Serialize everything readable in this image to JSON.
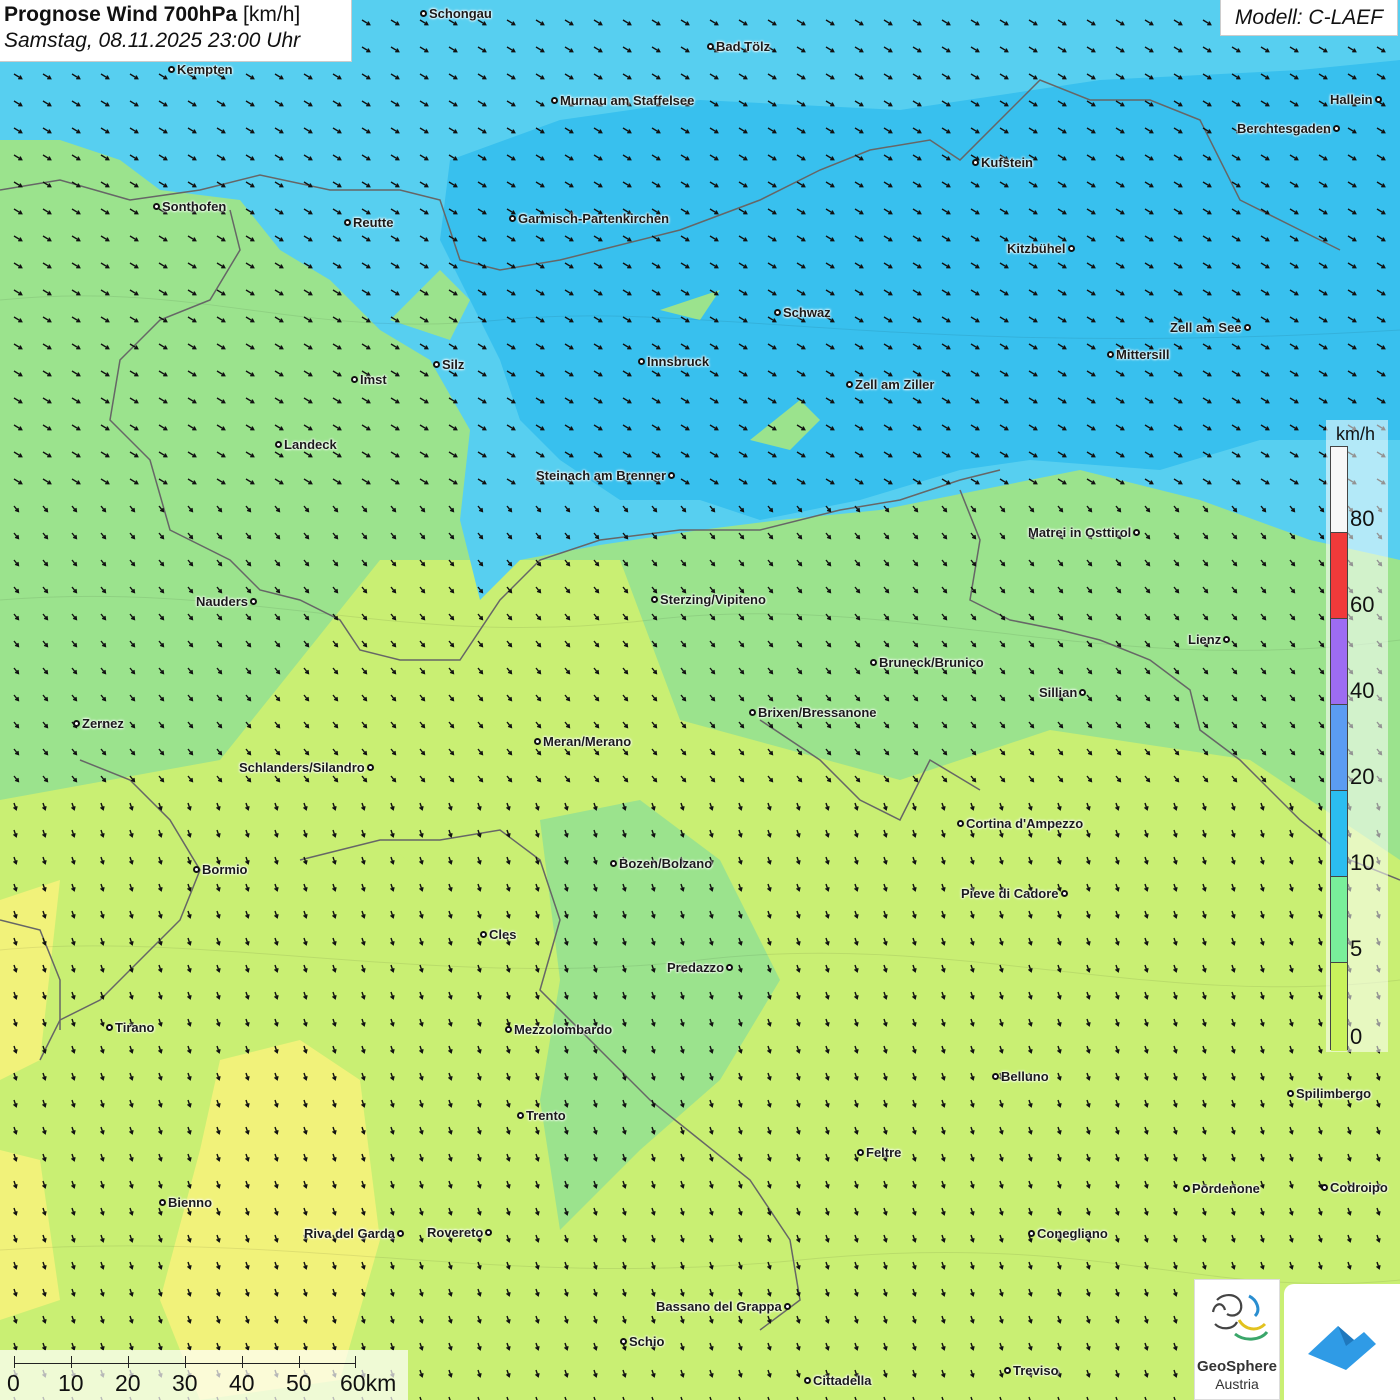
{
  "header": {
    "title_bold": "Prognose Wind 700hPa",
    "title_unit": "[km/h]",
    "subtitle": "Samstag, 08.11.2025 23:00 Uhr",
    "model": "Modell: C-LAEF"
  },
  "legend": {
    "unit": "km/h",
    "labels": [
      "80",
      "60",
      "40",
      "20",
      "10",
      "5",
      "0"
    ],
    "colors": [
      "#f7f7f7",
      "#f03a3a",
      "#9d6cf2",
      "#5b9cf2",
      "#2bbdf0",
      "#79ef9a",
      "#c9f25c",
      "#f5f56a"
    ]
  },
  "scale_bar": {
    "labels": [
      "0",
      "10",
      "20",
      "30",
      "40",
      "50",
      "60km"
    ]
  },
  "logos": {
    "geosphere_line1": "GeoSphere",
    "geosphere_line2": "Austria"
  },
  "cities": [
    {
      "name": "Schongau",
      "side": "right"
    },
    {
      "name": "Bad Tölz",
      "side": "right"
    },
    {
      "name": "Kempten",
      "side": "right"
    },
    {
      "name": "Murnau am Staffelsee",
      "side": "right"
    },
    {
      "name": "Hallein",
      "side": "left"
    },
    {
      "name": "Berchtesgaden",
      "side": "left"
    },
    {
      "name": "Kufstein",
      "side": "right"
    },
    {
      "name": "Sonthofen",
      "side": "right"
    },
    {
      "name": "Reutte",
      "side": "right"
    },
    {
      "name": "Garmisch-Partenkirchen",
      "side": "right"
    },
    {
      "name": "Kitzbühel",
      "side": "left"
    },
    {
      "name": "Schwaz",
      "side": "right"
    },
    {
      "name": "Zell am See",
      "side": "left"
    },
    {
      "name": "Innsbruck",
      "side": "right"
    },
    {
      "name": "Mittersill",
      "side": "right"
    },
    {
      "name": "Silz",
      "side": "right"
    },
    {
      "name": "Imst",
      "side": "right"
    },
    {
      "name": "Zell am Ziller",
      "side": "right"
    },
    {
      "name": "Landeck",
      "side": "right"
    },
    {
      "name": "Steinach am Brenner",
      "side": "left"
    },
    {
      "name": "Matrei in Osttirol",
      "side": "left"
    },
    {
      "name": "Nauders",
      "side": "left"
    },
    {
      "name": "Sterzing/Vipiteno",
      "side": "right"
    },
    {
      "name": "Lienz",
      "side": "left"
    },
    {
      "name": "Bruneck/Brunico",
      "side": "right"
    },
    {
      "name": "Sillian",
      "side": "left"
    },
    {
      "name": "Brixen/Bressanone",
      "side": "right"
    },
    {
      "name": "Zernez",
      "side": "right"
    },
    {
      "name": "Meran/Merano",
      "side": "right"
    },
    {
      "name": "Schlanders/Silandro",
      "side": "left"
    },
    {
      "name": "Cortina d'Ampezzo",
      "side": "right"
    },
    {
      "name": "Bozen/Bolzano",
      "side": "right"
    },
    {
      "name": "Bormio",
      "side": "right"
    },
    {
      "name": "Pieve di Cadore",
      "side": "left"
    },
    {
      "name": "Cles",
      "side": "right"
    },
    {
      "name": "Predazzo",
      "side": "left"
    },
    {
      "name": "Tirano",
      "side": "right"
    },
    {
      "name": "Mezzolombardo",
      "side": "right"
    },
    {
      "name": "Belluno",
      "side": "right"
    },
    {
      "name": "Spilimbergo",
      "side": "right"
    },
    {
      "name": "Trento",
      "side": "right"
    },
    {
      "name": "Feltre",
      "side": "right"
    },
    {
      "name": "Pordenone",
      "side": "right"
    },
    {
      "name": "Codroipo",
      "side": "right"
    },
    {
      "name": "Bienno",
      "side": "right"
    },
    {
      "name": "Riva del Garda",
      "side": "left"
    },
    {
      "name": "Rovereto",
      "side": "left"
    },
    {
      "name": "Conegliano",
      "side": "right"
    },
    {
      "name": "Bassano del Grappa",
      "side": "left"
    },
    {
      "name": "Schio",
      "side": "right"
    },
    {
      "name": "Treviso",
      "side": "right"
    },
    {
      "name": "Cittadella",
      "side": "right"
    }
  ]
}
